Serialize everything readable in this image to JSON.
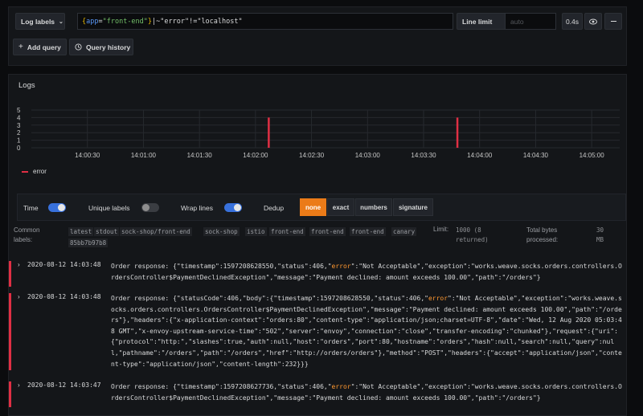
{
  "query_bar": {
    "log_labels_button": "Log labels",
    "query_parts": [
      {
        "cls": "tok-br",
        "text": "{"
      },
      {
        "cls": "tok-key",
        "text": "app"
      },
      {
        "cls": "tok-op",
        "text": "="
      },
      {
        "cls": "tok-str",
        "text": "\"front-end\""
      },
      {
        "cls": "tok-br",
        "text": "}"
      },
      {
        "cls": "tok-op",
        "text": "|~\"error\"!=\"localhost\""
      }
    ],
    "line_limit_label": "Line limit",
    "line_limit_placeholder": "auto",
    "duration": "0.4s",
    "add_query": "Add query",
    "query_history": "Query history"
  },
  "logs_panel": {
    "title": "Logs",
    "legend": "error",
    "options": {
      "time_label": "Time",
      "time_on": true,
      "unique_labels_label": "Unique labels",
      "unique_labels_on": false,
      "wrap_lines_label": "Wrap lines",
      "wrap_lines_on": true,
      "dedup_label": "Dedup",
      "dedup_options": [
        "none",
        "exact",
        "numbers",
        "signature"
      ],
      "dedup_selected": "none"
    },
    "meta": {
      "common_labels_label": "Common\nlabels:",
      "common_labels": [
        "latest",
        "stdout",
        "sock-shop/front-end",
        "sock-shop",
        "istio",
        "front-end",
        "front-end",
        "front-end",
        "canary",
        "85bb7b97b8"
      ],
      "limit_label": "Limit:",
      "limit_value": "1000 (8\nreturned)",
      "total_bytes_label": "Total bytes\nprocessed:",
      "total_bytes_value": "30\nMB"
    }
  },
  "chart_data": {
    "type": "bar",
    "series": [
      {
        "name": "error",
        "color": "#e02f44"
      }
    ],
    "x_ticks": [
      "14:00:30",
      "14:01:00",
      "14:01:30",
      "14:02:00",
      "14:02:30",
      "14:03:00",
      "14:03:30",
      "14:04:00",
      "14:04:30",
      "14:05:00"
    ],
    "y_ticks": [
      0,
      1,
      2,
      3,
      4,
      5
    ],
    "ylim": [
      0,
      5
    ],
    "bars": [
      {
        "time": "14:02:07",
        "value": 4
      },
      {
        "time": "14:03:48",
        "value": 4
      }
    ],
    "grid": true
  },
  "log_rows": [
    {
      "timestamp": "2020-08-12 14:03:48",
      "parts": [
        {
          "t": "Order response: {\"timestamp\":1597208628550,\"status\":406,\""
        },
        {
          "t": "error",
          "hl": true
        },
        {
          "t": "\":\"Not Acceptable\",\"exception\":\"works.weave.socks.orders.controllers.OrdersController$PaymentDeclinedException\",\"message\":\"Payment declined: amount exceeds 100.00\",\"path\":\"/orders\"}"
        }
      ]
    },
    {
      "timestamp": "2020-08-12 14:03:48",
      "parts": [
        {
          "t": "Order response: {\"statusCode\":406,\"body\":{\"timestamp\":1597208628550,\"status\":406,\""
        },
        {
          "t": "error",
          "hl": true
        },
        {
          "t": "\":\"Not Acceptable\",\"exception\":\"works.weave.socks.orders.controllers.OrdersController$PaymentDeclinedException\",\"message\":\"Payment declined: amount exceeds 100.00\",\"path\":\"/orders\"},\"headers\":{\"x-application-context\":\"orders:80\",\"content-type\":\"application/json;charset=UTF-8\",\"date\":\"Wed, 12 Aug 2020 05:03:48 GMT\",\"x-envoy-upstream-service-time\":\"502\",\"server\":\"envoy\",\"connection\":\"close\",\"transfer-encoding\":\"chunked\"},\"request\":{\"uri\":{\"protocol\":\"http:\",\"slashes\":true,\"auth\":null,\"host\":\"orders\",\"port\":80,\"hostname\":\"orders\",\"hash\":null,\"search\":null,\"query\":null,\"pathname\":\"/orders\",\"path\":\"/orders\",\"href\":\"http://orders/orders\"},\"method\":\"POST\",\"headers\":{\"accept\":\"application/json\",\"content-type\":\"application/json\",\"content-length\":232}}}"
        }
      ]
    },
    {
      "timestamp": "2020-08-12 14:03:47",
      "parts": [
        {
          "t": "Order response: {\"timestamp\":1597208627736,\"status\":406,\""
        },
        {
          "t": "error",
          "hl": true
        },
        {
          "t": "\":\"Not Acceptable\",\"exception\":\"works.weave.socks.orders.controllers.OrdersController$PaymentDeclinedException\",\"message\":\"Payment declined: amount exceeds 100.00\",\"path\":\"/orders\"}"
        }
      ]
    }
  ],
  "colors": {
    "accent": "#3871dc",
    "error": "#e02f44",
    "highlight": "#ff9830",
    "dedup_active": "#eb7b18"
  }
}
